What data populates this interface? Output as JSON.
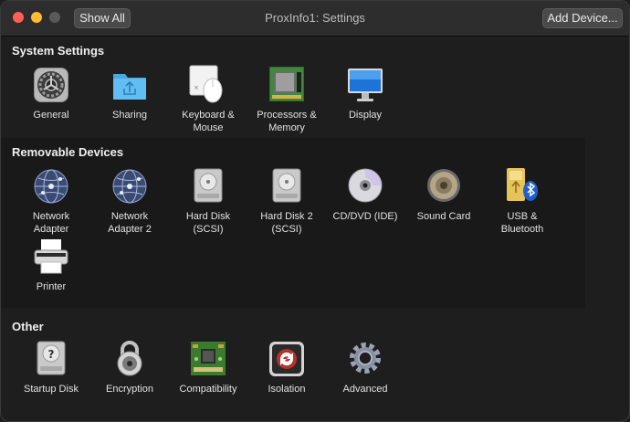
{
  "window": {
    "title": "ProxInfo1: Settings",
    "show_all_label": "Show All",
    "add_device_label": "Add Device..."
  },
  "sections": {
    "system": {
      "title": "System Settings",
      "items": [
        {
          "label": "General",
          "icon": "general-icon"
        },
        {
          "label": "Sharing",
          "icon": "sharing-folder-icon"
        },
        {
          "label": "Keyboard &\nMouse",
          "icon": "keyboard-mouse-icon"
        },
        {
          "label": "Processors &\nMemory",
          "icon": "memory-chip-icon"
        },
        {
          "label": "Display",
          "icon": "display-icon"
        }
      ]
    },
    "removable": {
      "title": "Removable Devices",
      "items": [
        {
          "label": "Network\nAdapter",
          "icon": "network-globe-icon"
        },
        {
          "label": "Network\nAdapter 2",
          "icon": "network-globe-icon"
        },
        {
          "label": "Hard Disk\n(SCSI)",
          "icon": "hard-disk-icon"
        },
        {
          "label": "Hard Disk 2\n(SCSI)",
          "icon": "hard-disk-icon"
        },
        {
          "label": "CD/DVD (IDE)",
          "icon": "cd-dvd-icon"
        },
        {
          "label": "Sound Card",
          "icon": "speaker-icon"
        },
        {
          "label": "USB &\nBluetooth",
          "icon": "usb-bluetooth-icon"
        },
        {
          "label": "Printer",
          "icon": "printer-icon"
        }
      ]
    },
    "other": {
      "title": "Other",
      "items": [
        {
          "label": "Startup Disk",
          "icon": "startup-disk-icon"
        },
        {
          "label": "Encryption",
          "icon": "padlock-icon"
        },
        {
          "label": "Compatibility",
          "icon": "circuit-board-icon"
        },
        {
          "label": "Isolation",
          "icon": "isolation-icon"
        },
        {
          "label": "Advanced",
          "icon": "advanced-gear-icon"
        }
      ]
    }
  }
}
